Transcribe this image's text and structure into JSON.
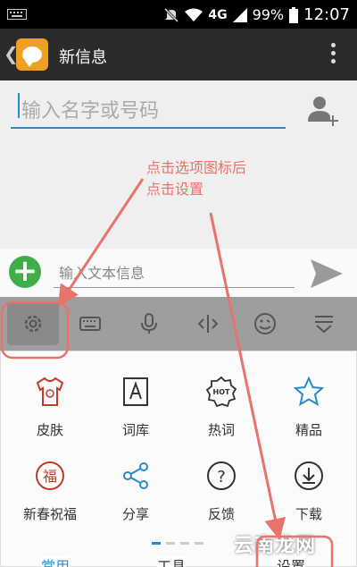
{
  "status_bar": {
    "battery": "99%",
    "time": "12:07",
    "network": "4G"
  },
  "header": {
    "title": "新信息"
  },
  "recipient": {
    "placeholder": "输入名字或号码"
  },
  "annotation": {
    "line1": "点击选项图标后",
    "line2": "点击设置"
  },
  "compose": {
    "placeholder": "输入文本信息"
  },
  "toolbar": {
    "items": [
      "gear-icon",
      "keyboard-icon",
      "microphone-icon",
      "cursor-icon",
      "emoji-icon",
      "collapse-icon"
    ]
  },
  "grid": {
    "items": [
      {
        "label": "皮肤",
        "icon": "tshirt-icon"
      },
      {
        "label": "词库",
        "icon": "dictionary-icon"
      },
      {
        "label": "热词",
        "icon": "hot-icon"
      },
      {
        "label": "精品",
        "icon": "star-icon"
      },
      {
        "label": "新春祝福",
        "icon": "blessing-icon"
      },
      {
        "label": "分享",
        "icon": "share-icon"
      },
      {
        "label": "反馈",
        "icon": "question-icon"
      },
      {
        "label": "下载",
        "icon": "download-icon"
      }
    ]
  },
  "tabs": [
    "常用",
    "工具",
    "设置"
  ],
  "watermark": "云南龙网",
  "colors": {
    "accent": "#2a8ac8",
    "annotation": "#e8736a",
    "green": "#3fae48"
  }
}
